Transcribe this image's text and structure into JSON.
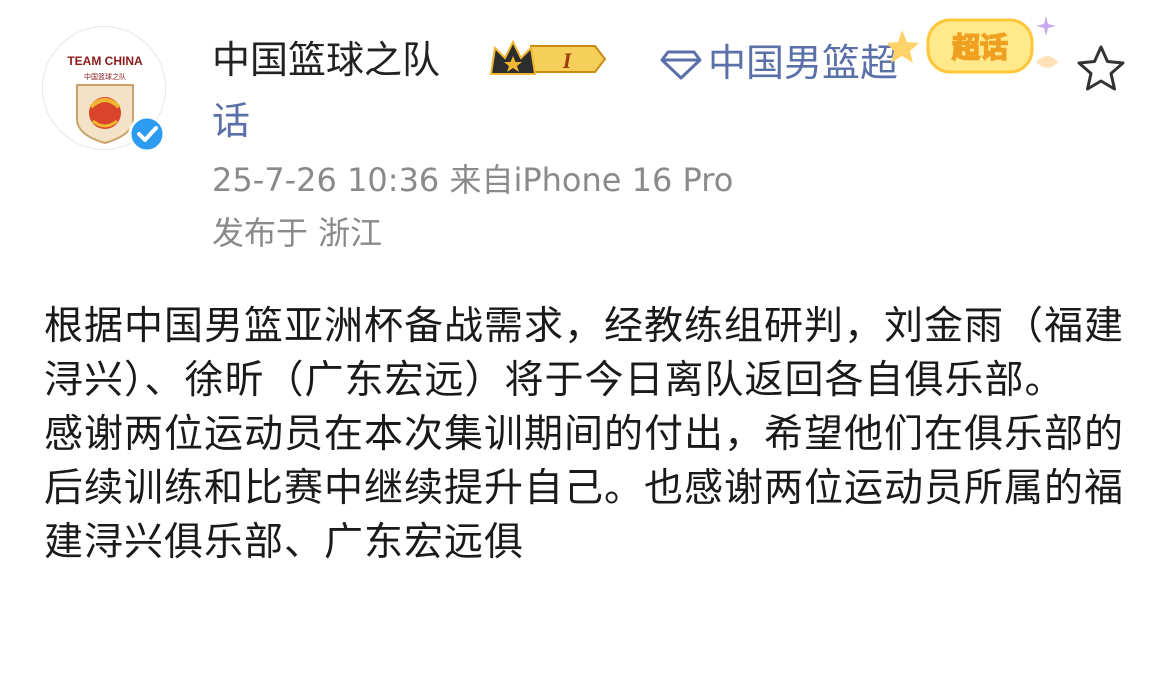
{
  "author": {
    "name": "中国篮球之队",
    "badge_level": "I",
    "avatar_text": "TEAM CHINA",
    "avatar_subtext": "中国篮球之队"
  },
  "supertopic": {
    "name": "中国男篮超话",
    "sticker_label": "超话"
  },
  "meta": {
    "time_source": "25-7-26 10:36  来自iPhone 16 Pro",
    "location": "发布于 浙江"
  },
  "content": {
    "paragraphs": [
      "根据中国男篮亚洲杯备战需求，经教练组研判，刘金雨（福建浔兴）、徐昕（广东宏远）将于今日离队返回各自俱乐部。",
      "感谢两位运动员在本次集训期间的付出，希望他们在俱乐部的后续训练和比赛中继续提升自己。也感谢两位运动员所属的福建浔兴俱乐部、广东宏远俱"
    ]
  },
  "colors": {
    "link": "#5b6fa8",
    "meta": "#8a8a8a",
    "verified": "#2b9cf0",
    "badge_gold": "#f0b730"
  },
  "icons": {
    "verified": "verified-check-icon",
    "crown": "crown-icon",
    "diamond": "diamond-icon",
    "star": "star-icon"
  }
}
